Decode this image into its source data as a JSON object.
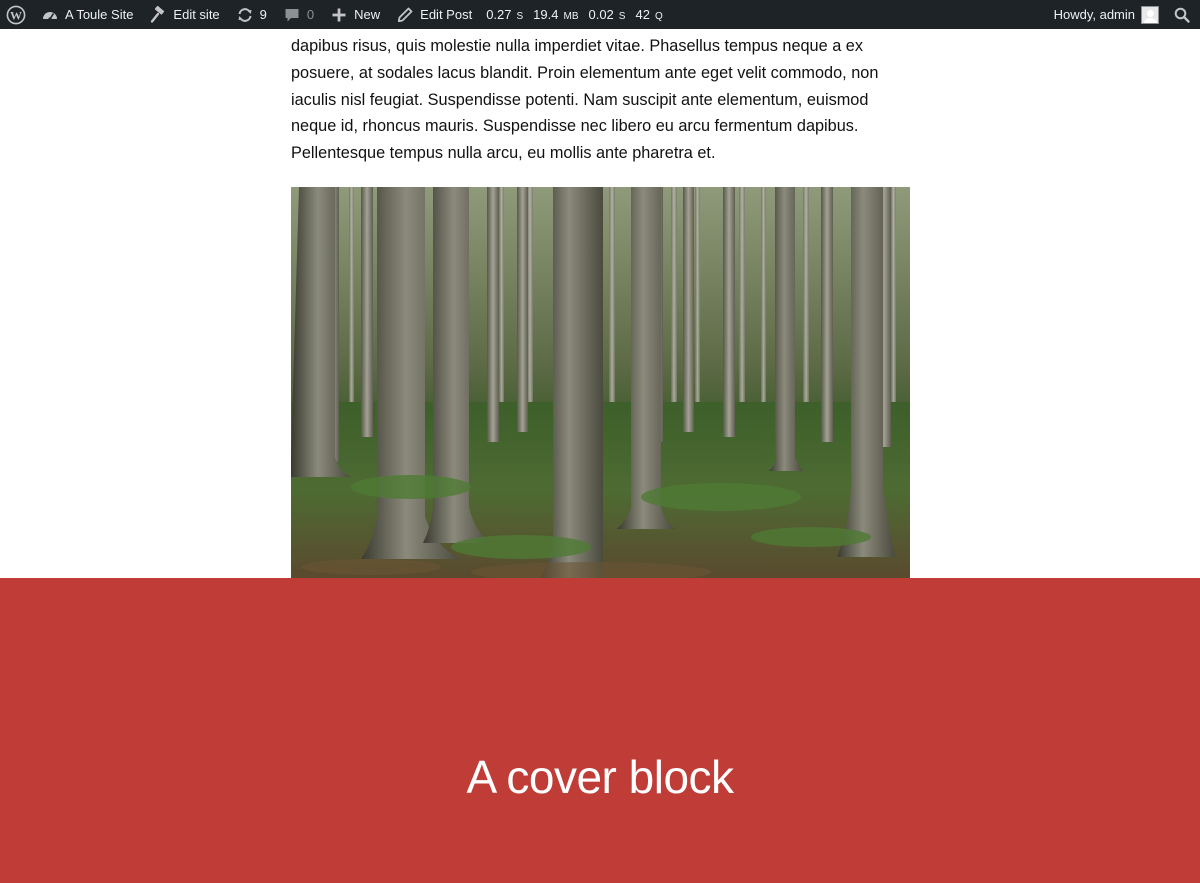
{
  "adminbar": {
    "site_name": "A Toule Site",
    "edit_site": "Edit site",
    "updates_count": "9",
    "comments_count": "0",
    "new_label": "New",
    "edit_post": "Edit Post",
    "query_monitor": {
      "time": "0.27",
      "time_unit": "S",
      "memory": "19.4",
      "memory_unit": "MB",
      "db_time": "0.02",
      "db_time_unit": "S",
      "queries": "42",
      "queries_unit": "Q"
    },
    "howdy": "Howdy, admin",
    "icons": [
      "wordpress-logo-icon",
      "dashboard-icon",
      "hammer-icon",
      "updates-icon",
      "comment-icon",
      "plus-icon",
      "pencil-icon",
      "avatar",
      "search-icon"
    ]
  },
  "content": {
    "paragraph": "dapibus risus, quis molestie nulla imperdiet vitae. Phasellus tempus neque a ex posuere, at sodales lacus blandit. Proin elementum ante eget velit commodo, non iaculis nisl feugiat. Suspendisse potenti. Nam suscipit ante elementum, euismod neque id, rhoncus mauris. Suspendisse nec libero eu arcu fermentum dapibus. Pellentesque tempus nulla arcu, eu mollis ante pharetra et."
  },
  "cover": {
    "heading": "A cover block",
    "background_color": "#c03c36"
  },
  "colors": {
    "adminbar_bg": "#1d2327",
    "adminbar_text": "#f0f0f1",
    "cover_bg": "#c03c36"
  }
}
